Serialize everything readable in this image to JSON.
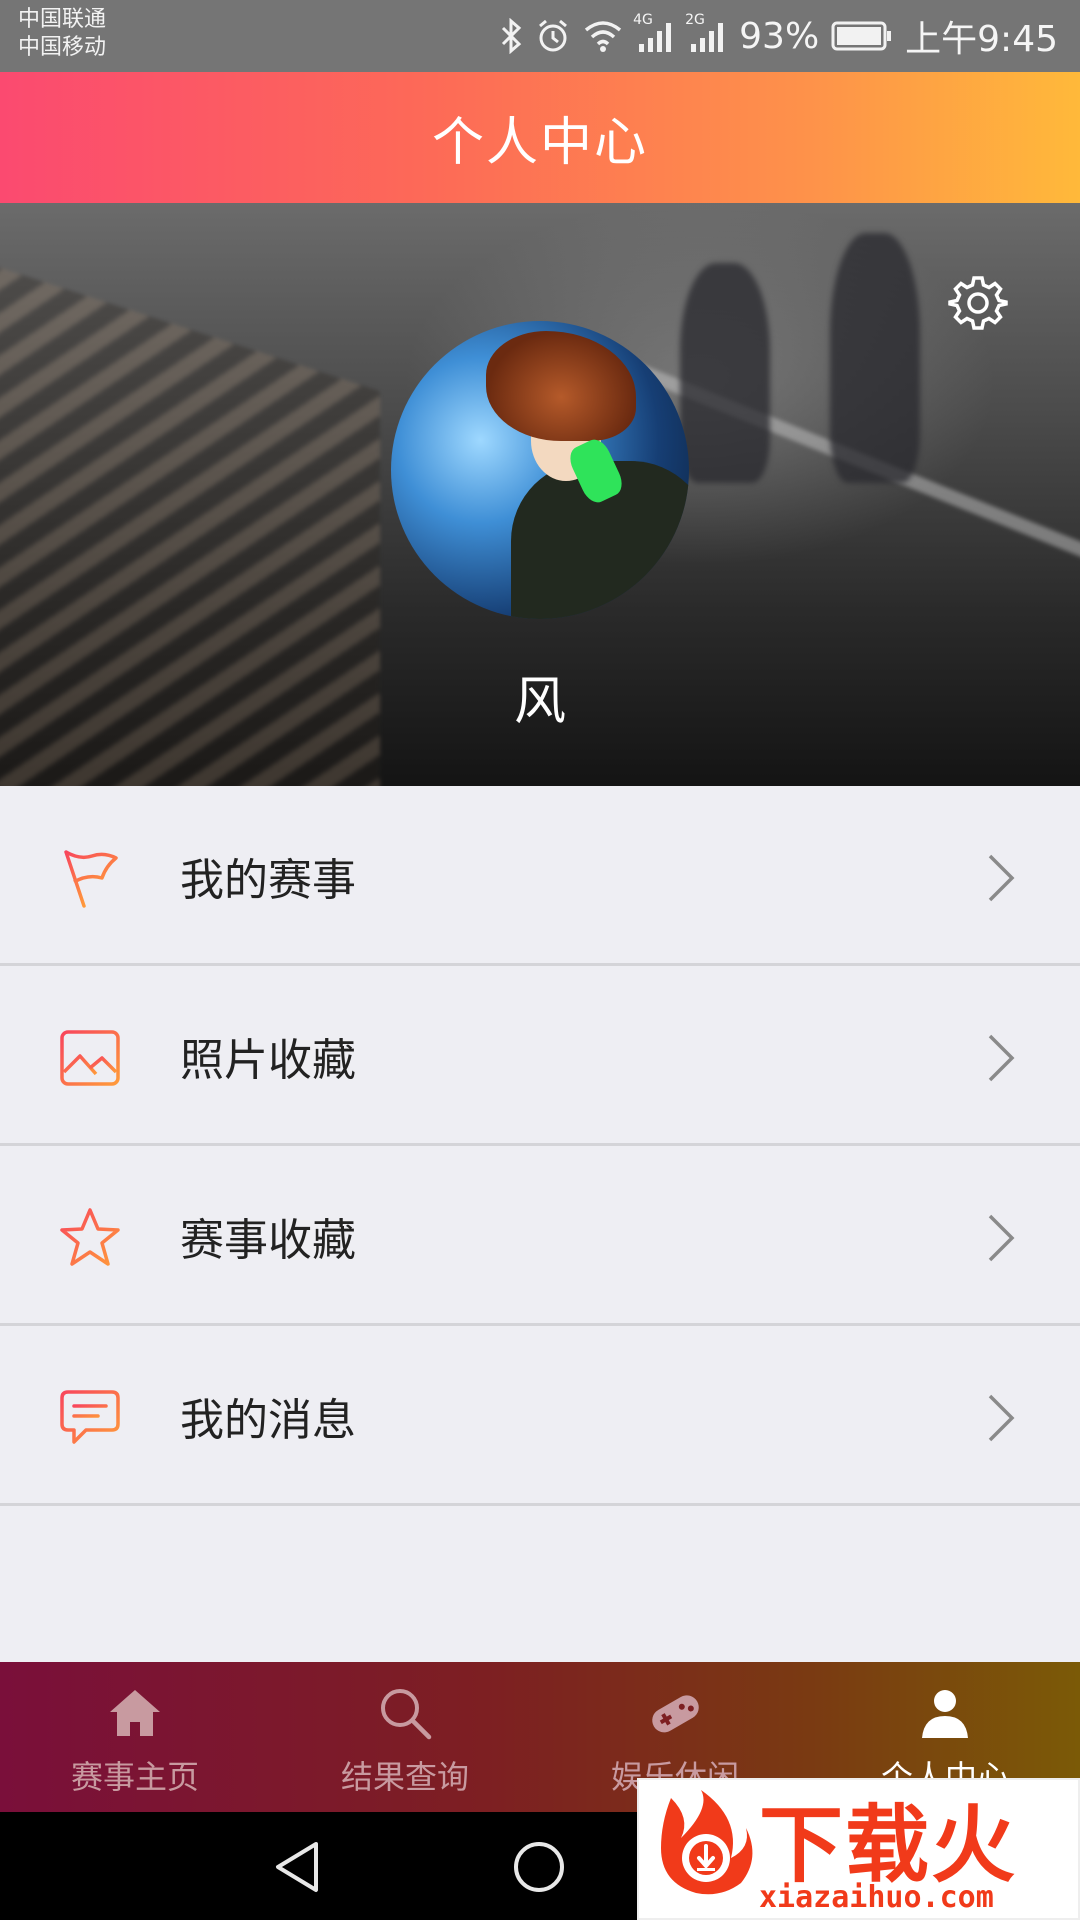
{
  "status_bar": {
    "carrier_1": "中国联通",
    "carrier_2": "中国移动",
    "network_1": "4G",
    "network_2": "2G",
    "battery": "93%",
    "time": "上午9:45",
    "icons": [
      "bluetooth-icon",
      "alarm-icon",
      "wifi-icon",
      "signal-icon",
      "battery-icon"
    ]
  },
  "header": {
    "title": "个人中心"
  },
  "profile": {
    "username": "风",
    "settings_icon": "gear-icon"
  },
  "menu": {
    "items": [
      {
        "label": "我的赛事",
        "icon": "flag-icon"
      },
      {
        "label": "照片收藏",
        "icon": "image-icon"
      },
      {
        "label": "赛事收藏",
        "icon": "star-icon"
      },
      {
        "label": "我的消息",
        "icon": "message-icon"
      }
    ]
  },
  "bottom_nav": {
    "items": [
      {
        "label": "赛事主页",
        "icon": "home-icon",
        "active": false
      },
      {
        "label": "结果查询",
        "icon": "search-icon",
        "active": false
      },
      {
        "label": "娱乐休闲",
        "icon": "gamepad-icon",
        "active": false
      },
      {
        "label": "个人中心",
        "icon": "user-icon",
        "active": true
      }
    ]
  },
  "watermark": {
    "text": "下载火",
    "url": "xiazaihuo.com"
  },
  "colors": {
    "header_start": "#fb4a70",
    "header_end": "#ffb93a",
    "accent_orange": "#f5653a",
    "nav_start": "#7a0f3a",
    "nav_end": "#7b5a07"
  }
}
